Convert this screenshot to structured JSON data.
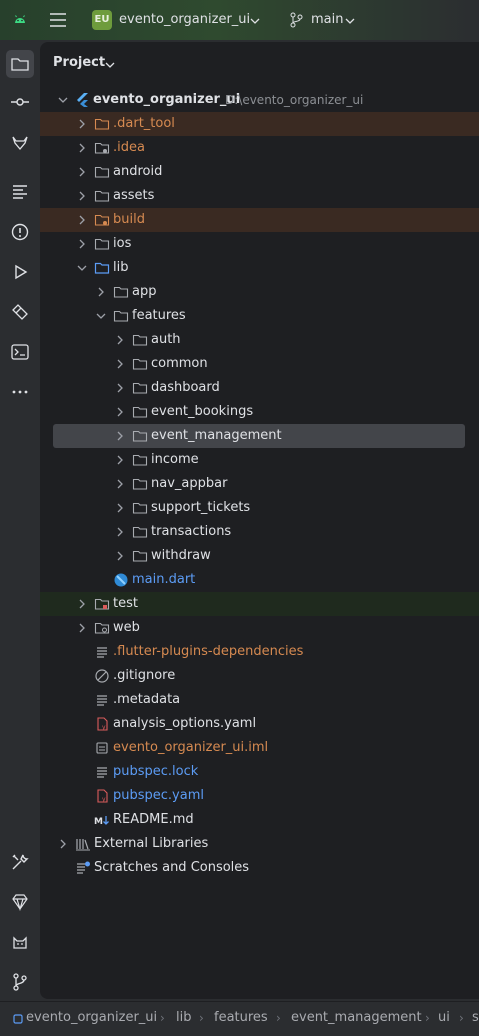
{
  "titlebar": {
    "project_badge": "EU",
    "project_name": "evento_organizer_ui",
    "branch": "main"
  },
  "panel": {
    "title": "Project"
  },
  "tree": {
    "root": {
      "label": "evento_organizer_ui",
      "path": "D:\\evento_organizer_ui"
    },
    "items": [
      {
        "label": ".dart_tool"
      },
      {
        "label": ".idea"
      },
      {
        "label": "android"
      },
      {
        "label": "assets"
      },
      {
        "label": "build"
      },
      {
        "label": "ios"
      },
      {
        "label": "lib"
      },
      {
        "label": "app"
      },
      {
        "label": "features"
      },
      {
        "label": "auth"
      },
      {
        "label": "common"
      },
      {
        "label": "dashboard"
      },
      {
        "label": "event_bookings"
      },
      {
        "label": "event_management"
      },
      {
        "label": "income"
      },
      {
        "label": "nav_appbar"
      },
      {
        "label": "support_tickets"
      },
      {
        "label": "transactions"
      },
      {
        "label": "withdraw"
      },
      {
        "label": "main.dart"
      },
      {
        "label": "test"
      },
      {
        "label": "web"
      },
      {
        "label": ".flutter-plugins-dependencies"
      },
      {
        "label": ".gitignore"
      },
      {
        "label": ".metadata"
      },
      {
        "label": "analysis_options.yaml"
      },
      {
        "label": "evento_organizer_ui.iml"
      },
      {
        "label": "pubspec.lock"
      },
      {
        "label": "pubspec.yaml"
      },
      {
        "label": "README.md"
      },
      {
        "label": "External Libraries"
      },
      {
        "label": "Scratches and Consoles"
      }
    ]
  },
  "breadcrumb": [
    "evento_organizer_ui",
    "lib",
    "features",
    "event_management",
    "ui",
    "s"
  ],
  "colors": {
    "accent_orange": "#d68a51",
    "accent_blue": "#5c9cf5",
    "selection": "#43454a",
    "badge": "#6e9c3c"
  },
  "icons": {
    "stripe": [
      "folder-icon",
      "commit-icon",
      "gitlab-icon",
      "structure-icon",
      "problems-icon",
      "run-icon",
      "build-icon",
      "terminal-icon",
      "more-icon",
      "tools-icon",
      "gem-icon",
      "cat-icon",
      "git-icon"
    ]
  }
}
